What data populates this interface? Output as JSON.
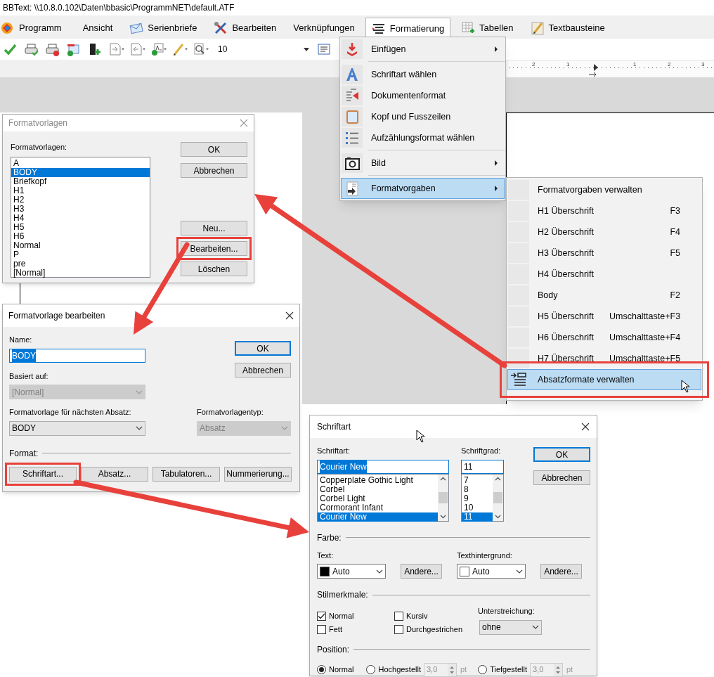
{
  "window": {
    "title": "BBText: \\\\10.8.0.102\\Daten\\bbasic\\ProgrammNET\\default.ATF"
  },
  "menu_bar": [
    {
      "label": "Programm",
      "selected": false
    },
    {
      "label": "Ansicht",
      "selected": false
    },
    {
      "label": "Serienbriefe",
      "selected": false
    },
    {
      "label": "Bearbeiten",
      "selected": false
    },
    {
      "label": "Verknüpfungen",
      "selected": false
    },
    {
      "label": "Formatierung",
      "selected": true
    },
    {
      "label": "Tabellen",
      "selected": false
    },
    {
      "label": "Textbausteine",
      "selected": false
    }
  ],
  "toolbar": {
    "font_size": "10"
  },
  "ruler": {
    "labels": [
      "2",
      "1",
      "1",
      "2",
      "3"
    ]
  },
  "format_menu": {
    "items": [
      {
        "kind": "item",
        "label": "Einfügen",
        "submenu": true,
        "selected": false
      },
      {
        "kind": "separator"
      },
      {
        "kind": "item",
        "label": "Schriftart wählen",
        "submenu": false,
        "selected": false
      },
      {
        "kind": "item",
        "label": "Dokumentenformat",
        "submenu": false,
        "selected": false
      },
      {
        "kind": "item",
        "label": "Kopf und Fusszeilen",
        "submenu": false,
        "selected": false
      },
      {
        "kind": "item",
        "label": "Aufzählungsformat wählen",
        "submenu": false,
        "selected": false
      },
      {
        "kind": "separator"
      },
      {
        "kind": "item",
        "label": "Bild",
        "submenu": true,
        "selected": false
      },
      {
        "kind": "separator"
      },
      {
        "kind": "item",
        "label": "Formatvorgaben",
        "submenu": true,
        "selected": true
      }
    ]
  },
  "submenu": {
    "items": [
      {
        "label": "Formatvorgaben verwalten",
        "selected": false,
        "annotated": false
      },
      {
        "label": "H1 Überschrift",
        "shortcut": "F3",
        "selected": false,
        "annotated": false
      },
      {
        "label": "H2 Überschrift",
        "shortcut": "F4",
        "selected": false,
        "annotated": false
      },
      {
        "label": "H3 Überschrift",
        "shortcut": "F5",
        "selected": false,
        "annotated": false
      },
      {
        "label": "H4 Überschrift",
        "selected": false,
        "annotated": false
      },
      {
        "label": "Body",
        "shortcut": "F2",
        "selected": false,
        "annotated": false
      },
      {
        "label": "H5 Überschrift",
        "shortcut": "Umschalttaste+F3",
        "selected": false,
        "annotated": false
      },
      {
        "label": "H6 Überschrift",
        "shortcut": "Umschalttaste+F4",
        "selected": false,
        "annotated": false
      },
      {
        "label": "H7 Überschrift",
        "shortcut": "Umschalttaste+F5",
        "selected": false,
        "annotated": false
      },
      {
        "label": "Absatzformate verwalten",
        "selected": true,
        "annotated": true
      }
    ]
  },
  "styles_dialog": {
    "title": "Formatvorlagen",
    "list_label": "Formatvorlagen:",
    "items": [
      {
        "label": "A",
        "selected": false
      },
      {
        "label": "BODY",
        "selected": true
      },
      {
        "label": "Briefkopf",
        "selected": false
      },
      {
        "label": "H1",
        "selected": false
      },
      {
        "label": "H2",
        "selected": false
      },
      {
        "label": "H3",
        "selected": false
      },
      {
        "label": "H4",
        "selected": false
      },
      {
        "label": "H5",
        "selected": false
      },
      {
        "label": "H6",
        "selected": false
      },
      {
        "label": "Normal",
        "selected": false
      },
      {
        "label": "P",
        "selected": false
      },
      {
        "label": "pre",
        "selected": false
      },
      {
        "label": "[Normal]",
        "selected": false
      }
    ],
    "buttons": [
      {
        "label": "OK",
        "annotated": false
      },
      {
        "label": "Abbrechen",
        "annotated": false
      },
      {
        "label": "Neu...",
        "annotated": false
      },
      {
        "label": "Bearbeiten...",
        "annotated": true
      },
      {
        "label": "Löschen",
        "annotated": false
      }
    ]
  },
  "edit_dialog": {
    "title": "Formatvorlage bearbeiten",
    "name": {
      "label": "Name:",
      "value": "BODY",
      "text_selected": true
    },
    "based_on": {
      "label": "Basiert auf:",
      "value": "[Normal]",
      "disabled": true
    },
    "next_style": {
      "label": "Formatvorlage für nächsten Absatz:",
      "value": "BODY",
      "disabled": false
    },
    "style_type": {
      "label": "Formatvorlagentyp:",
      "value": "Absatz",
      "disabled": true
    },
    "ok": {
      "label": "OK",
      "focused": true
    },
    "cancel": {
      "label": "Abbrechen",
      "focused": false
    },
    "format_label": "Format:",
    "format_buttons": [
      {
        "label": "Schriftart...",
        "annotated": true
      },
      {
        "label": "Absatz...",
        "annotated": false
      },
      {
        "label": "Tabulatoren...",
        "annotated": false
      },
      {
        "label": "Nummerierung...",
        "annotated": false
      }
    ]
  },
  "font_dialog": {
    "title": "Schriftart",
    "font": {
      "label": "Schriftart:",
      "value": "Courier New",
      "text_selected": true,
      "items": [
        {
          "label": "Copperplate Gothic Light",
          "selected": false
        },
        {
          "label": "Corbel",
          "selected": false
        },
        {
          "label": "Corbel Light",
          "selected": false
        },
        {
          "label": "Cormorant Infant",
          "selected": false
        },
        {
          "label": "Courier New",
          "selected": true
        }
      ]
    },
    "size": {
      "label": "Schriftgrad:",
      "value": "11",
      "text_selected": false,
      "items": [
        {
          "label": "7",
          "selected": false
        },
        {
          "label": "8",
          "selected": false
        },
        {
          "label": "9",
          "selected": false
        },
        {
          "label": "10",
          "selected": false
        },
        {
          "label": "11",
          "selected": true
        }
      ]
    },
    "ok": {
      "label": "OK",
      "focused": true
    },
    "cancel": {
      "label": "Abbrechen",
      "focused": false
    },
    "color_group": "Farbe:",
    "text_color": {
      "label": "Text:",
      "value": "Auto",
      "color": "#000000",
      "button": "Andere..."
    },
    "background_color": {
      "label": "Texthintergrund:",
      "value": "Auto",
      "color": "#ffffff",
      "button": "Andere..."
    },
    "style_group": "Stilmerkmale:",
    "styles": [
      {
        "label": "Normal",
        "checked": true
      },
      {
        "label": "Fett",
        "checked": false
      },
      {
        "label": "Kursiv",
        "checked": false
      },
      {
        "label": "Durchgestrichen",
        "checked": false
      }
    ],
    "underline": {
      "label": "Unterstreichung:",
      "value": "ohne"
    },
    "position_group": "Position:",
    "positions": [
      {
        "label": "Normal",
        "selected": true
      },
      {
        "label": "Hochgestellt",
        "selected": false,
        "amount": "3,0",
        "unit": "pt",
        "disabled": true
      },
      {
        "label": "Tiefgestellt",
        "selected": false,
        "amount": "3,0",
        "unit": "pt",
        "disabled": true
      }
    ]
  }
}
